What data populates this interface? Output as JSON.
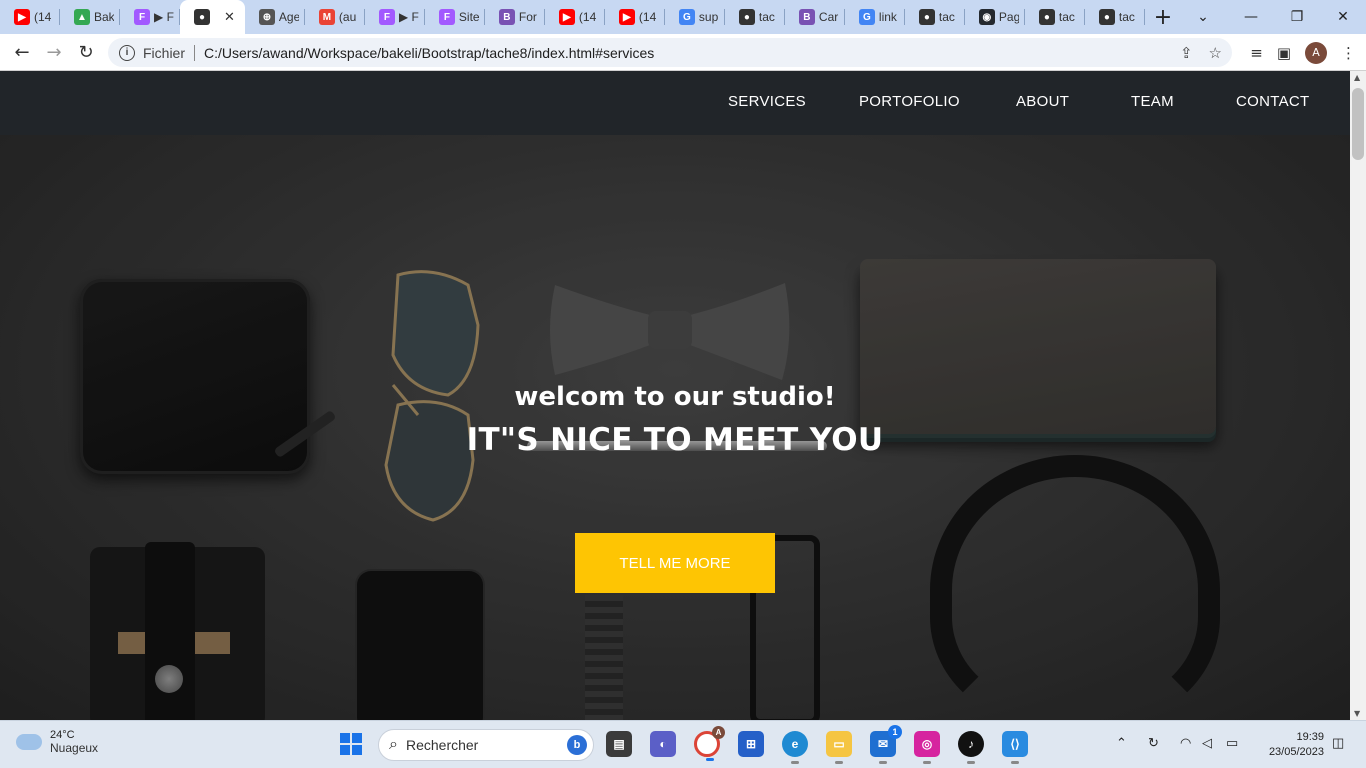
{
  "browser": {
    "tabs": [
      {
        "title": "(14",
        "icon": "youtube-icon",
        "color": "#ff0000",
        "glyph": "▶"
      },
      {
        "title": "Bak",
        "icon": "drive-icon",
        "color": "#34a853",
        "glyph": "▲"
      },
      {
        "title": "▶ F",
        "icon": "figma-icon",
        "color": "#a259ff",
        "glyph": "F"
      },
      {
        "title": "",
        "icon": "globe-icon",
        "color": "#333333",
        "glyph": "●",
        "active": true
      },
      {
        "title": "Age",
        "icon": "web-icon",
        "color": "#555555",
        "glyph": "⊕"
      },
      {
        "title": "(au",
        "icon": "gmail-icon",
        "color": "#ea4335",
        "glyph": "M"
      },
      {
        "title": "▶ F",
        "icon": "figma-icon",
        "color": "#a259ff",
        "glyph": "F"
      },
      {
        "title": "Site",
        "icon": "figma-icon",
        "color": "#a259ff",
        "glyph": "F"
      },
      {
        "title": "For",
        "icon": "bootstrap-icon",
        "color": "#7952b3",
        "glyph": "B"
      },
      {
        "title": "(14",
        "icon": "youtube-icon",
        "color": "#ff0000",
        "glyph": "▶"
      },
      {
        "title": "(14",
        "icon": "youtube-icon",
        "color": "#ff0000",
        "glyph": "▶"
      },
      {
        "title": "sup",
        "icon": "google-icon",
        "color": "#4285f4",
        "glyph": "G"
      },
      {
        "title": "tac",
        "icon": "globe-icon",
        "color": "#333333",
        "glyph": "●"
      },
      {
        "title": "Car",
        "icon": "bootstrap-icon",
        "color": "#7952b3",
        "glyph": "B"
      },
      {
        "title": "link",
        "icon": "google-icon",
        "color": "#4285f4",
        "glyph": "G"
      },
      {
        "title": "tac",
        "icon": "globe-icon",
        "color": "#333333",
        "glyph": "●"
      },
      {
        "title": "Pag",
        "icon": "github-icon",
        "color": "#24292f",
        "glyph": "◉"
      },
      {
        "title": "tac",
        "icon": "globe-icon",
        "color": "#333333",
        "glyph": "●"
      },
      {
        "title": "tac",
        "icon": "globe-icon",
        "color": "#333333",
        "glyph": "●"
      }
    ],
    "new_tab": "+",
    "scheme_label": "Fichier",
    "url": "C:/Users/awand/Workspace/bakeli/Bootstrap/tache8/index.html#services",
    "profile_initial": "A"
  },
  "site": {
    "nav": [
      "SERVICES",
      "PORTOFOLIO",
      "ABOUT",
      "TEAM",
      "CONTACT"
    ],
    "hero_subheading": "welcom to our studio!",
    "hero_heading": "IT\"S NICE TO MEET YOU",
    "cta_label": "TELL ME MORE",
    "cta_color": "#fec503",
    "nav_bg": "#212529"
  },
  "taskbar": {
    "temperature": "24°C",
    "weather": "Nuageux",
    "search_placeholder": "Rechercher",
    "time": "19:39",
    "date": "23/05/2023",
    "mail_badge": "1",
    "chrome_badge": "A"
  }
}
